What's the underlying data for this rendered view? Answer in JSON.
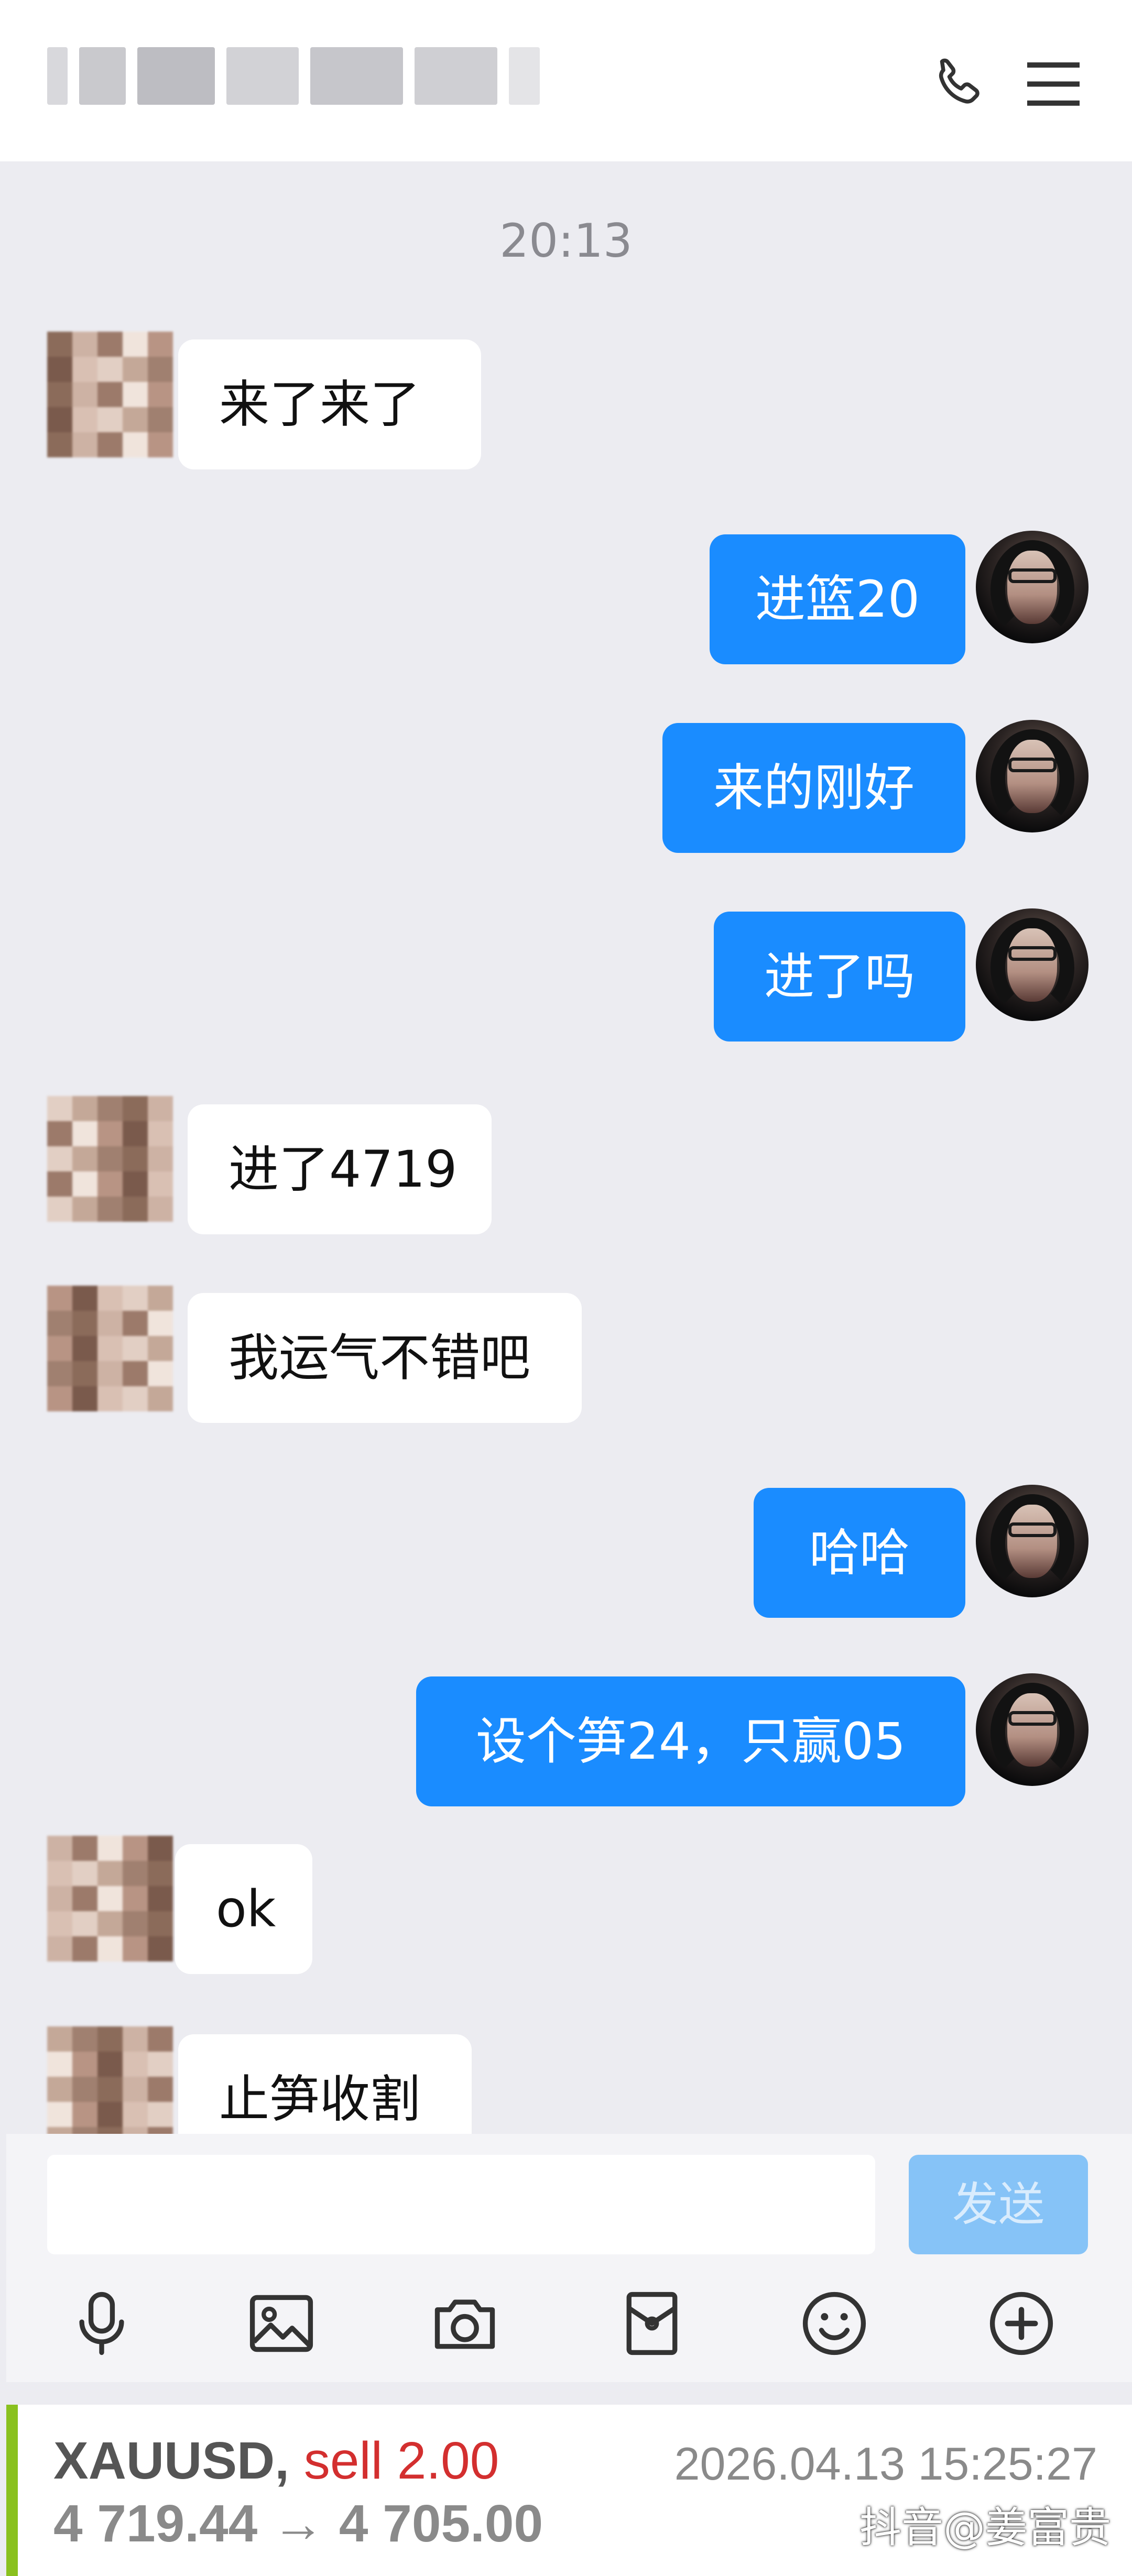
{
  "header": {
    "title_blurred": true
  },
  "chat": {
    "timestamp": "20:13",
    "messages": [
      {
        "side": "in",
        "text": "来了来了"
      },
      {
        "side": "out",
        "text": "进篮20"
      },
      {
        "side": "out",
        "text": "来的刚好"
      },
      {
        "side": "out",
        "text": "进了吗"
      },
      {
        "side": "in",
        "text": "进了4719"
      },
      {
        "side": "in",
        "text": "我运气不错吧"
      },
      {
        "side": "out",
        "text": "哈哈"
      },
      {
        "side": "out",
        "text": "设个笋24，只赢05"
      },
      {
        "side": "in",
        "text": "ok"
      },
      {
        "side": "in",
        "text": "止笋收割"
      }
    ]
  },
  "composer": {
    "send_label": "发送",
    "tools": [
      "microphone-icon",
      "image-icon",
      "camera-icon",
      "red-packet-icon",
      "emoji-icon",
      "plus-icon"
    ]
  },
  "trade": {
    "symbol": "XAUUSD,",
    "side": "sell 2.00",
    "prices": "4 719.44 → 4 705.00",
    "datetime": "2026.04.13 15:25:27",
    "watermark": "抖音@姜富贵",
    "accent_color": "#8ac11f",
    "sell_color": "#d32f2f"
  },
  "colors": {
    "outgoing_bubble": "#1a8cff",
    "incoming_bubble": "#ffffff",
    "chat_background": "#ececf1"
  }
}
